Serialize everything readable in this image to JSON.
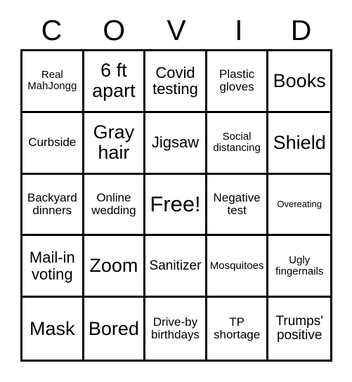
{
  "card": {
    "header_letters": [
      "C",
      "O",
      "V",
      "I",
      "D"
    ],
    "grid": {
      "rows": [
        [
          {
            "text": "Real MahJongg",
            "size": "sz-s"
          },
          {
            "text": "6 ft apart",
            "size": "sz-xxl"
          },
          {
            "text": "Covid testing",
            "size": "sz-xl"
          },
          {
            "text": "Plastic gloves",
            "size": "sz-m"
          },
          {
            "text": "Books",
            "size": "sz-xxl"
          }
        ],
        [
          {
            "text": "Curbside",
            "size": "sz-m"
          },
          {
            "text": "Gray hair",
            "size": "sz-xxl"
          },
          {
            "text": "Jigsaw",
            "size": "sz-xl"
          },
          {
            "text": "Social distancing",
            "size": "sz-s"
          },
          {
            "text": "Shield",
            "size": "sz-xxl"
          }
        ],
        [
          {
            "text": "Backyard dinners",
            "size": "sz-m"
          },
          {
            "text": "Online wedding",
            "size": "sz-m"
          },
          {
            "text": "Free!",
            "size": "sz-huge"
          },
          {
            "text": "Negative test",
            "size": "sz-m"
          },
          {
            "text": "Overeating",
            "size": "sz-xs"
          }
        ],
        [
          {
            "text": "Mail-in voting",
            "size": "sz-xl"
          },
          {
            "text": "Zoom",
            "size": "sz-xxl"
          },
          {
            "text": "Sanitizer",
            "size": "sz-l"
          },
          {
            "text": "Mosquitoes",
            "size": "sz-s"
          },
          {
            "text": "Ugly fingernails",
            "size": "sz-s"
          }
        ],
        [
          {
            "text": "Mask",
            "size": "sz-xxl"
          },
          {
            "text": "Bored",
            "size": "sz-xxl"
          },
          {
            "text": "Drive-by birthdays",
            "size": "sz-m"
          },
          {
            "text": "TP shortage",
            "size": "sz-m"
          },
          {
            "text": "Trumps' positive",
            "size": "sz-l"
          }
        ]
      ]
    },
    "colors": {
      "background": "#ffffff",
      "ink": "#000000",
      "grid_line": "#000000"
    }
  }
}
